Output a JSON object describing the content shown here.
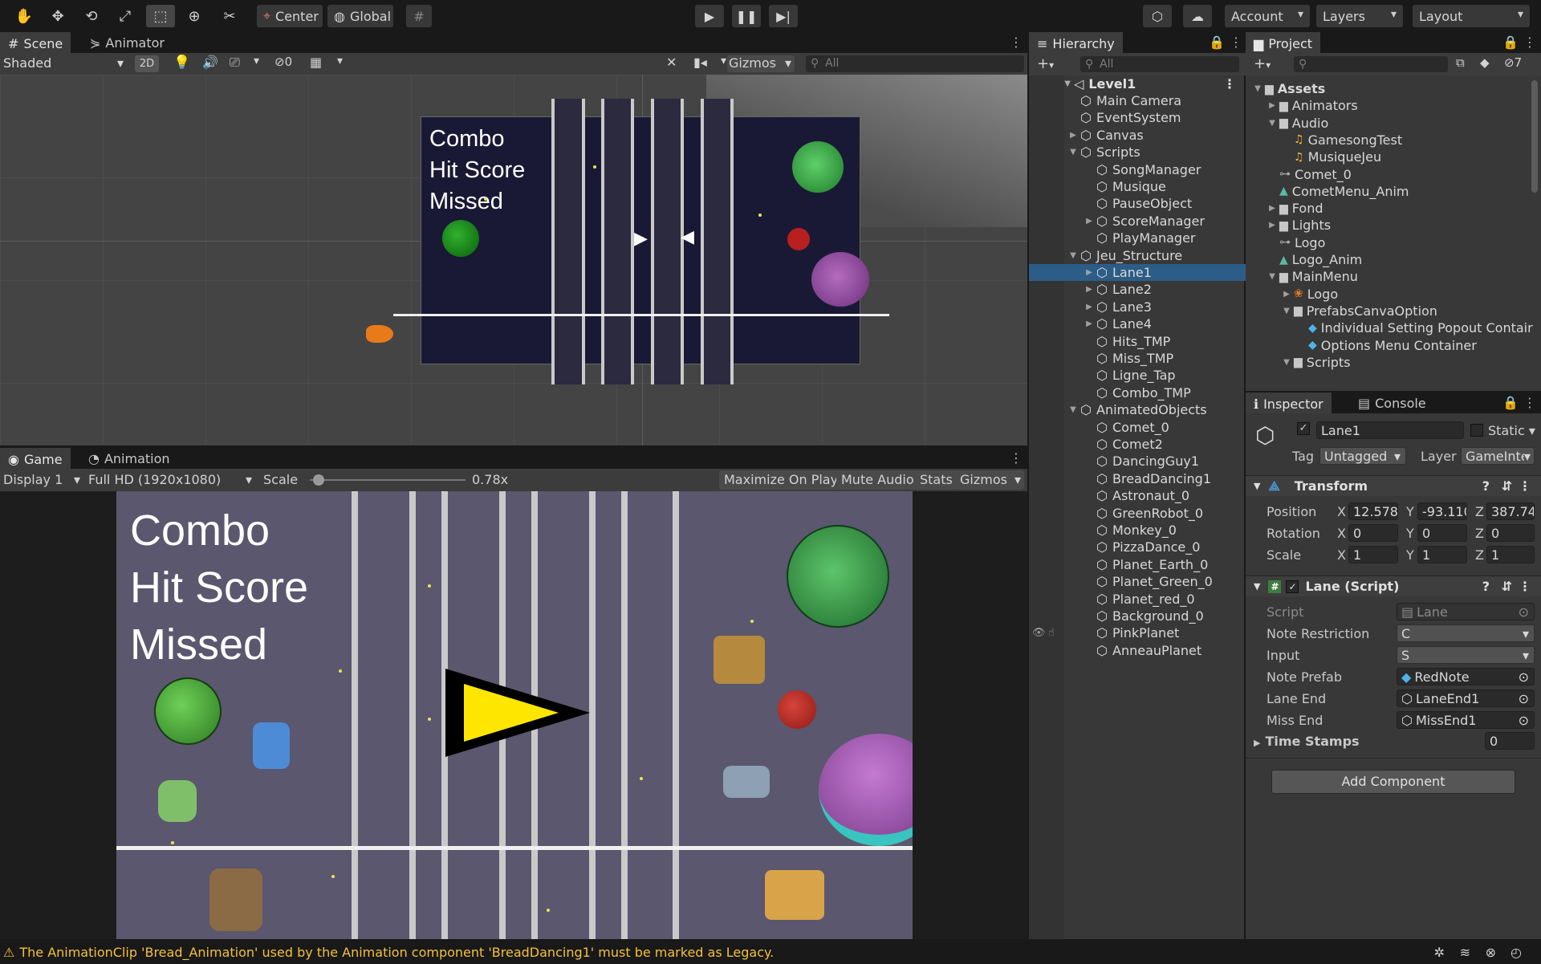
{
  "toolbar": {
    "tools": [
      {
        "name": "hand-tool-icon",
        "glyph": "✋"
      },
      {
        "name": "move-tool-icon",
        "glyph": "✥"
      },
      {
        "name": "rotate-tool-icon",
        "glyph": "⟲"
      },
      {
        "name": "scale-tool-icon",
        "glyph": "⤢"
      },
      {
        "name": "rect-tool-icon",
        "glyph": "⬚"
      },
      {
        "name": "transform-tool-icon",
        "glyph": "⊕"
      },
      {
        "name": "custom-tool-icon",
        "glyph": "✂"
      }
    ],
    "pivot_label": "Center",
    "space_label": "Global",
    "account_label": "Account",
    "layers_label": "Layers",
    "layout_label": "Layout"
  },
  "scene_panel": {
    "tab_scene": "Scene",
    "tab_animator": "Animator",
    "shading_mode": "Shaded",
    "mode_2d": "2D",
    "hidden_count": "0",
    "gizmos_label": "Gizmos",
    "search_placeholder": "All",
    "canvas_text": [
      "Combo",
      "Hit Score",
      "Missed"
    ]
  },
  "game_panel": {
    "tab_game": "Game",
    "tab_animation": "Animation",
    "display": "Display 1",
    "resolution": "Full HD (1920x1080)",
    "scale_label": "Scale",
    "scale_value": "0.78x",
    "scale_fraction": 0.05,
    "maximize": "Maximize On Play",
    "mute": "Mute Audio",
    "stats": "Stats",
    "gizmos": "Gizmos",
    "ui_text": [
      "Combo",
      "Hit Score",
      "Missed"
    ]
  },
  "hierarchy": {
    "tab": "Hierarchy",
    "search_placeholder": "All",
    "scene_name": "Level1",
    "items": [
      {
        "label": "Main Camera",
        "indent": 1,
        "arrow": ""
      },
      {
        "label": "EventSystem",
        "indent": 1,
        "arrow": ""
      },
      {
        "label": "Canvas",
        "indent": 1,
        "arrow": "▶"
      },
      {
        "label": "Scripts",
        "indent": 1,
        "arrow": "▼"
      },
      {
        "label": "SongManager",
        "indent": 2,
        "arrow": ""
      },
      {
        "label": "Musique",
        "indent": 2,
        "arrow": ""
      },
      {
        "label": "PauseObject",
        "indent": 2,
        "arrow": ""
      },
      {
        "label": "ScoreManager",
        "indent": 2,
        "arrow": "▶"
      },
      {
        "label": "PlayManager",
        "indent": 2,
        "arrow": ""
      },
      {
        "label": "Jeu_Structure",
        "indent": 1,
        "arrow": "▼"
      },
      {
        "label": "Lane1",
        "indent": 2,
        "arrow": "▶",
        "selected": true
      },
      {
        "label": "Lane2",
        "indent": 2,
        "arrow": "▶"
      },
      {
        "label": "Lane3",
        "indent": 2,
        "arrow": "▶"
      },
      {
        "label": "Lane4",
        "indent": 2,
        "arrow": "▶"
      },
      {
        "label": "Hits_TMP",
        "indent": 2,
        "arrow": ""
      },
      {
        "label": "Miss_TMP",
        "indent": 2,
        "arrow": ""
      },
      {
        "label": "Ligne_Tap",
        "indent": 2,
        "arrow": ""
      },
      {
        "label": "Combo_TMP",
        "indent": 2,
        "arrow": ""
      },
      {
        "label": "AnimatedObjects",
        "indent": 1,
        "arrow": "▼"
      },
      {
        "label": "Comet_0",
        "indent": 2,
        "arrow": ""
      },
      {
        "label": "Comet2",
        "indent": 2,
        "arrow": ""
      },
      {
        "label": "DancingGuy1",
        "indent": 2,
        "arrow": ""
      },
      {
        "label": "BreadDancing1",
        "indent": 2,
        "arrow": ""
      },
      {
        "label": "Astronaut_0",
        "indent": 2,
        "arrow": ""
      },
      {
        "label": "GreenRobot_0",
        "indent": 2,
        "arrow": ""
      },
      {
        "label": "Monkey_0",
        "indent": 2,
        "arrow": ""
      },
      {
        "label": "PizzaDance_0",
        "indent": 2,
        "arrow": ""
      },
      {
        "label": "Planet_Earth_0",
        "indent": 2,
        "arrow": ""
      },
      {
        "label": "Planet_Green_0",
        "indent": 2,
        "arrow": ""
      },
      {
        "label": "Planet_red_0",
        "indent": 2,
        "arrow": ""
      },
      {
        "label": "Background_0",
        "indent": 2,
        "arrow": ""
      },
      {
        "label": "PinkPlanet",
        "indent": 2,
        "arrow": "",
        "hover": true
      },
      {
        "label": "AnneauPlanet",
        "indent": 2,
        "arrow": ""
      }
    ]
  },
  "project": {
    "tab": "Project",
    "hidden_count": "7",
    "items": [
      {
        "label": "Assets",
        "level": 0,
        "arrow": "▼",
        "icon": "folder-open",
        "bold": true
      },
      {
        "label": "Animators",
        "level": 1,
        "arrow": "▶",
        "icon": "folder"
      },
      {
        "label": "Audio",
        "level": 1,
        "arrow": "▼",
        "icon": "folder-open"
      },
      {
        "label": "GamesongTest",
        "level": 2,
        "arrow": "",
        "icon": "audio"
      },
      {
        "label": "MusiqueJeu",
        "level": 2,
        "arrow": "",
        "icon": "audio"
      },
      {
        "label": "Comet_0",
        "level": 1,
        "arrow": "",
        "icon": "anim-controller"
      },
      {
        "label": "CometMenu_Anim",
        "level": 1,
        "arrow": "",
        "icon": "anim-clip"
      },
      {
        "label": "Fond",
        "level": 1,
        "arrow": "▶",
        "icon": "folder"
      },
      {
        "label": "Lights",
        "level": 1,
        "arrow": "▶",
        "icon": "folder"
      },
      {
        "label": "Logo",
        "level": 1,
        "arrow": "",
        "icon": "anim-controller"
      },
      {
        "label": "Logo_Anim",
        "level": 1,
        "arrow": "",
        "icon": "anim-clip"
      },
      {
        "label": "MainMenu",
        "level": 1,
        "arrow": "▼",
        "icon": "folder-open"
      },
      {
        "label": "Logo",
        "level": 2,
        "arrow": "▶",
        "icon": "sprite"
      },
      {
        "label": "PrefabsCanvaOption",
        "level": 2,
        "arrow": "▼",
        "icon": "folder-open"
      },
      {
        "label": "Individual Setting Popout Contair",
        "level": 3,
        "arrow": "",
        "icon": "prefab"
      },
      {
        "label": "Options Menu Container",
        "level": 3,
        "arrow": "",
        "icon": "prefab"
      },
      {
        "label": "Scripts",
        "level": 2,
        "arrow": "▼",
        "icon": "folder-open"
      }
    ]
  },
  "inspector": {
    "tab_inspector": "Inspector",
    "tab_console": "Console",
    "object_name": "Lane1",
    "static_label": "Static",
    "tag_label": "Tag",
    "tag_value": "Untagged",
    "layer_label": "Layer",
    "layer_value": "GameInte",
    "transform": {
      "title": "Transform",
      "position_label": "Position",
      "rotation_label": "Rotation",
      "scale_label": "Scale",
      "position": [
        "12.5789",
        "-93.110",
        "387.74"
      ],
      "rotation": [
        "0",
        "0",
        "0"
      ],
      "scale": [
        "1",
        "1",
        "1"
      ]
    },
    "lane_script": {
      "title": "Lane (Script)",
      "script_label": "Script",
      "script_value": "Lane",
      "note_restriction_label": "Note Restriction",
      "note_restriction_value": "C",
      "input_label": "Input",
      "input_value": "S",
      "note_prefab_label": "Note Prefab",
      "note_prefab_value": "RedNote",
      "lane_end_label": "Lane End",
      "lane_end_value": "LaneEnd1",
      "miss_end_label": "Miss End",
      "miss_end_value": "MissEnd1",
      "time_stamps_label": "Time Stamps",
      "time_stamps_value": "0"
    },
    "add_component": "Add Component"
  },
  "status_bar": {
    "message": "The AnimationClip 'Bread_Animation' used by the Animation component 'BreadDancing1' must be marked as Legacy."
  },
  "colors": {
    "selection": "#2c5d87",
    "warning": "#f4c13b",
    "game_bg": "#5a576e",
    "scene_canvas_bg": "#1a1935",
    "accent_yellow": "#ffe600"
  }
}
